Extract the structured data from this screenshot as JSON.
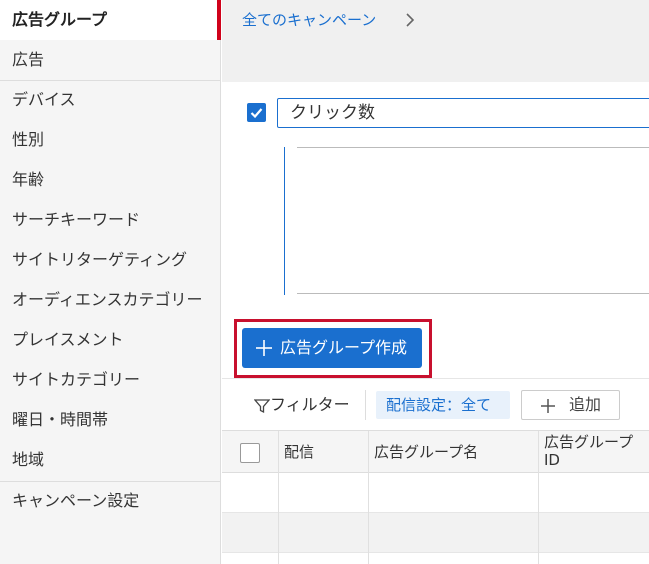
{
  "sidebar": {
    "items": [
      {
        "label": "広告グループ",
        "active": true
      },
      {
        "label": "広告"
      },
      {
        "label": "デバイス"
      },
      {
        "label": "性別"
      },
      {
        "label": "年齢"
      },
      {
        "label": "サーチキーワード"
      },
      {
        "label": "サイトリターゲティング"
      },
      {
        "label": "オーディエンスカテゴリー"
      },
      {
        "label": "プレイスメント"
      },
      {
        "label": "サイトカテゴリー"
      },
      {
        "label": "曜日・時間帯"
      },
      {
        "label": "地域"
      },
      {
        "label": "キャンペーン設定"
      }
    ]
  },
  "breadcrumb": {
    "label": "全てのキャンペーン"
  },
  "metric": {
    "checked": true,
    "value": "クリック数"
  },
  "create_button": {
    "label": "広告グループ作成"
  },
  "toolbar": {
    "filter_label": "フィルター",
    "delivery_chip": "配信設定：全て",
    "add_label": "追加"
  },
  "table": {
    "columns": [
      "配信",
      "広告グループ名",
      "広告グループ\nID"
    ]
  },
  "colors": {
    "accent": "#1a6fcf",
    "active_marker": "#d0021b",
    "highlight_box": "#c8102e"
  }
}
